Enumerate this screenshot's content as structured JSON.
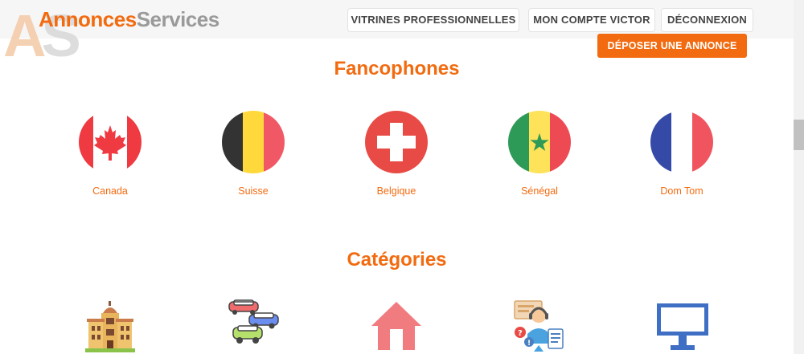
{
  "header": {
    "logo_main": "Annonces",
    "logo_secondary": "Services",
    "logo_mark": "AS",
    "nav": [
      {
        "label": "VITRINES PROFESSIONNELLES"
      },
      {
        "label": "MON COMPTE VICTOR"
      },
      {
        "label": "DÉCONNEXION"
      }
    ],
    "deposit_label": "DÉPOSER UNE ANNONCE"
  },
  "francophones": {
    "title": "Fancophones",
    "countries": [
      {
        "label": "Canada",
        "icon": "canada-flag-icon"
      },
      {
        "label": "Suisse",
        "icon": "belgium-flag-icon"
      },
      {
        "label": "Belgique",
        "icon": "switzerland-flag-icon"
      },
      {
        "label": "Sénégal",
        "icon": "senegal-flag-icon"
      },
      {
        "label": "Dom Tom",
        "icon": "france-flag-icon"
      }
    ]
  },
  "categories": {
    "title": "Catégories",
    "items": [
      {
        "icon": "building-icon"
      },
      {
        "icon": "cars-icon"
      },
      {
        "icon": "house-icon"
      },
      {
        "icon": "services-person-icon"
      },
      {
        "icon": "computer-monitor-icon"
      }
    ]
  },
  "colors": {
    "accent": "#f26b10",
    "header_bg": "#f6f6f6"
  }
}
